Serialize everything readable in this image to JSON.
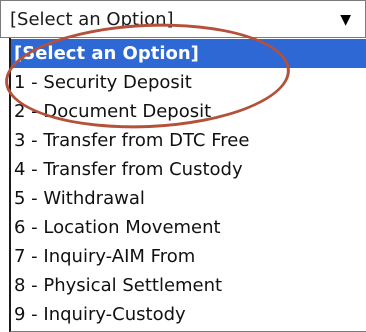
{
  "select": {
    "current_value": "[Select an Option]",
    "arrow_icon": "triangle-down-icon"
  },
  "options": [
    {
      "label": "[Select an Option]",
      "selected": true
    },
    {
      "label": "1 - Security Deposit",
      "selected": false
    },
    {
      "label": "2 - Document Deposit",
      "selected": false
    },
    {
      "label": "3 - Transfer from DTC Free",
      "selected": false
    },
    {
      "label": "4 - Transfer from Custody",
      "selected": false
    },
    {
      "label": "5 - Withdrawal",
      "selected": false
    },
    {
      "label": "6 - Location Movement",
      "selected": false
    },
    {
      "label": "7 - Inquiry-AIM From",
      "selected": false
    },
    {
      "label": "8 - Physical Settlement",
      "selected": false
    },
    {
      "label": "9 - Inquiry-Custody",
      "selected": false
    }
  ],
  "colors": {
    "selected_background": "#2e68d5",
    "annotation_ring": "#b4513a"
  }
}
